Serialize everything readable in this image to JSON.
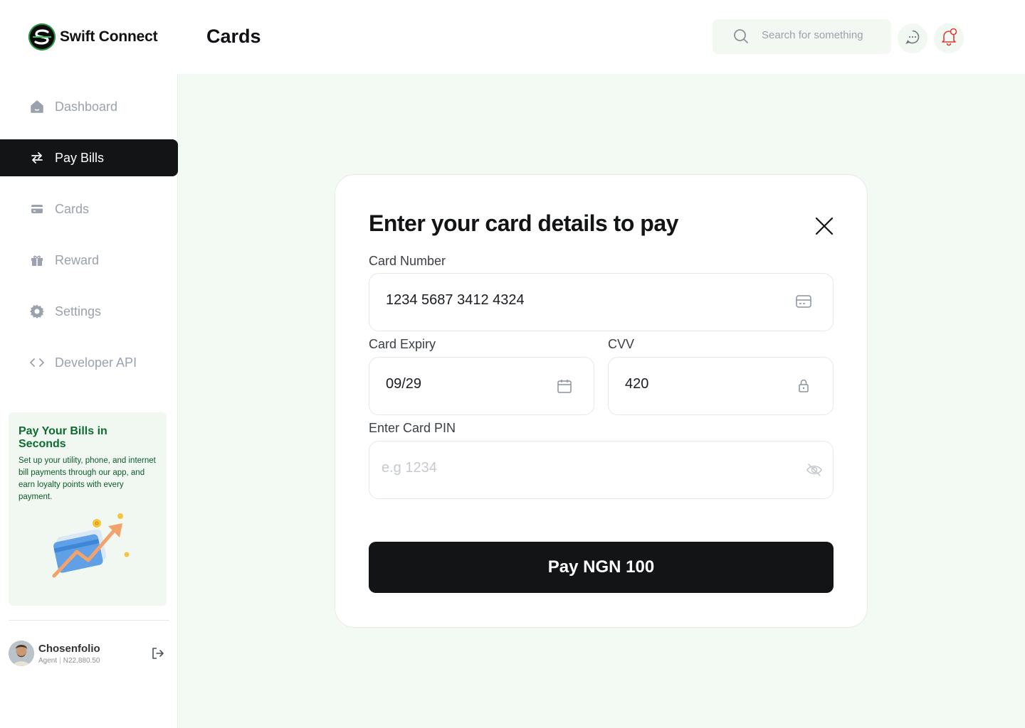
{
  "brand": {
    "name": "Swift Connect"
  },
  "header": {
    "title": "Cards",
    "search_placeholder": "Search for something"
  },
  "sidebar": {
    "items": [
      {
        "label": "Dashboard",
        "icon": "home-icon",
        "active": false
      },
      {
        "label": "Pay Bills",
        "icon": "transfer-icon",
        "active": true
      },
      {
        "label": "Cards",
        "icon": "card-icon",
        "active": false
      },
      {
        "label": "Reward",
        "icon": "gift-icon",
        "active": false
      },
      {
        "label": "Settings",
        "icon": "gear-icon",
        "active": false
      },
      {
        "label": "Developer API",
        "icon": "code-icon",
        "active": false
      }
    ],
    "promo": {
      "title": "Pay Your Bills in Seconds",
      "text": "Set up your utility, phone, and internet bill payments through our app, and earn loyalty points with every payment."
    },
    "user": {
      "name": "Chosenfolio",
      "role": "Agent",
      "balance": "N22,880.50"
    }
  },
  "modal": {
    "title": "Enter your card details to pay",
    "card_number_label": "Card Number",
    "card_number_value": "1234 5687 3412 4324",
    "expiry_label": "Card Expiry",
    "expiry_value": "09/29",
    "cvv_label": "CVV",
    "cvv_value": "420",
    "pin_label": "Enter Card PIN",
    "pin_placeholder": "e.g 1234",
    "pay_button": "Pay NGN 100"
  },
  "colors": {
    "accent_dark": "#121416",
    "background_green": "#f3f9f3",
    "promo_text_green": "#0c6b2f",
    "notification_red": "#e03b3b"
  }
}
